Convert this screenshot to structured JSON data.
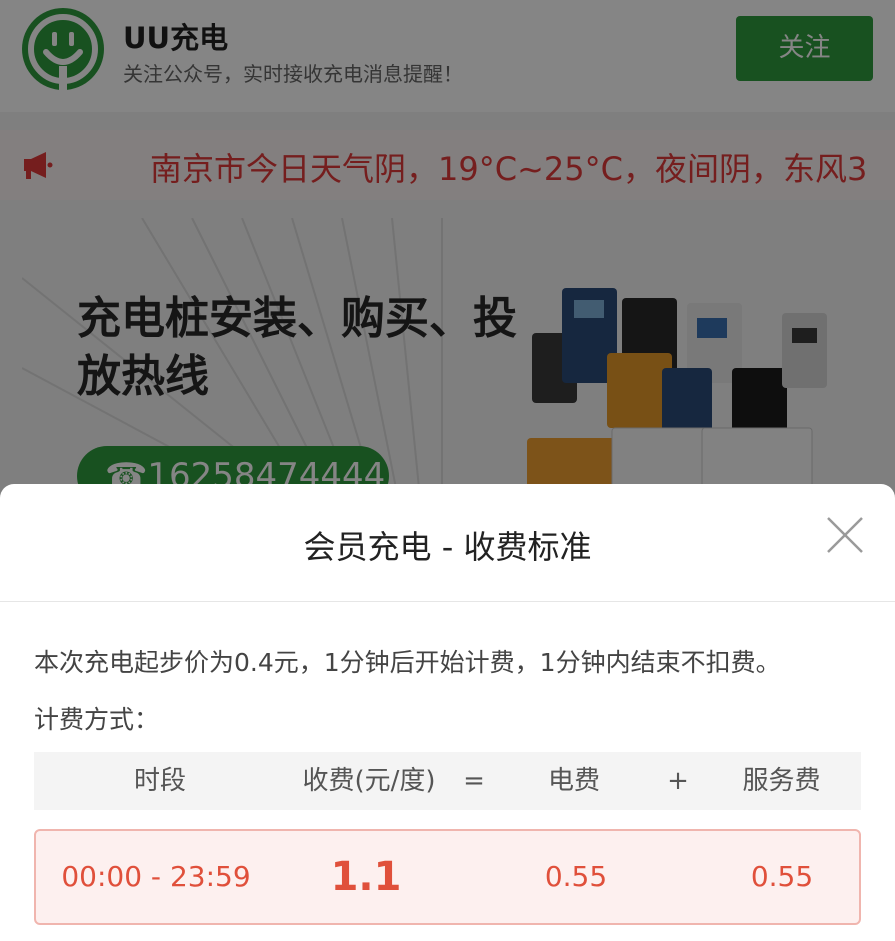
{
  "account": {
    "name": "UU充电",
    "subtitle": "关注公众号，实时接收充电消息提醒！",
    "follow_label": "关注"
  },
  "notice": {
    "text": "南京市今日天气阴，19°C~25°C，夜间阴，东风3"
  },
  "banner": {
    "title": "充电桩安装、购买、投放热线",
    "phone": "☎16258474444"
  },
  "sheet": {
    "title": "会员充电 - 收费标准",
    "description": "本次充电起步价为0.4元，1分钟后开始计费，1分钟内结束不扣费。",
    "method_label": "计费方式：",
    "table": {
      "headers": [
        "时段",
        "收费(元/度)",
        "=",
        "电费",
        "+",
        "服务费"
      ],
      "rows": [
        {
          "period": "00:00 - 23:59",
          "fee": "1.1",
          "electricity": "0.55",
          "service": "0.55"
        }
      ]
    }
  },
  "colors": {
    "brand_green": "#2e9b3f",
    "alert_red": "#e03a3a",
    "row_bg": "#fdf0ef"
  },
  "icons": {
    "notice": "megaphone-icon",
    "close": "close-icon",
    "logo": "smiley-plug-logo"
  }
}
